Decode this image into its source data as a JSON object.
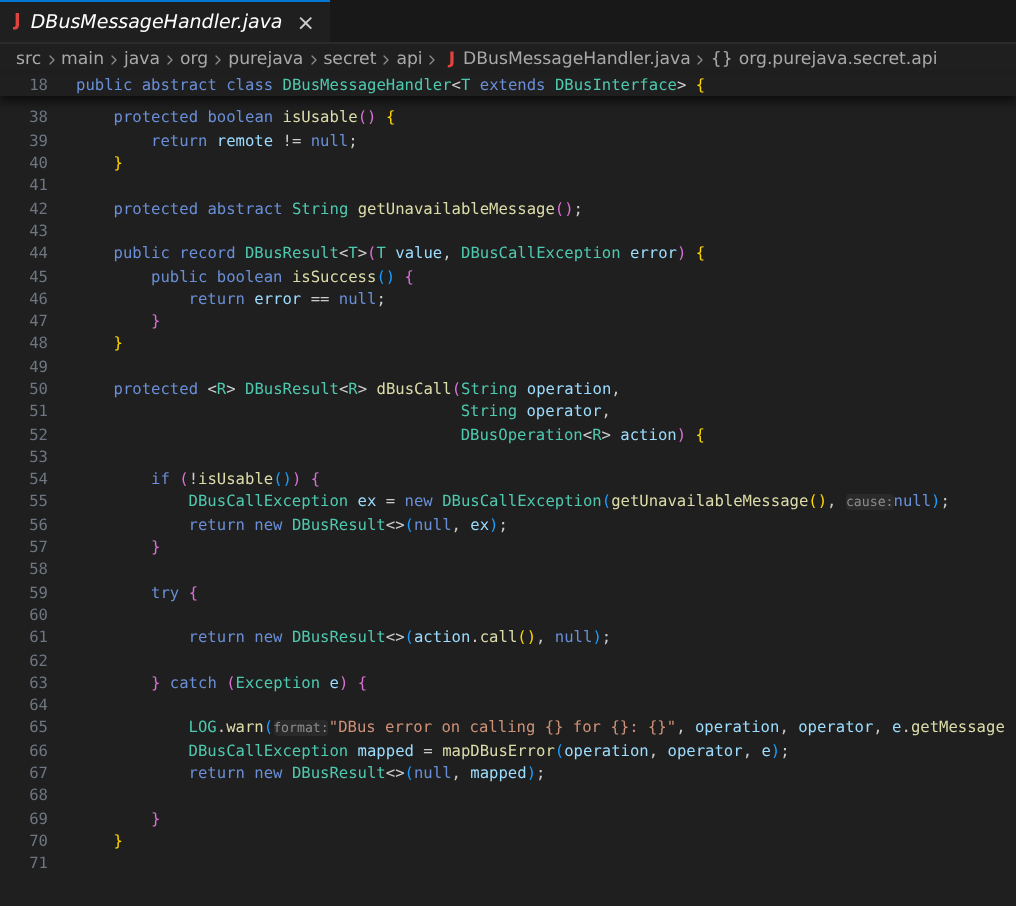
{
  "tab": {
    "icon_glyph": "J",
    "label": "DBusMessageHandler.java",
    "close_glyph": "×",
    "selected": true
  },
  "breadcrumb": {
    "folders": [
      "src",
      "main",
      "java",
      "org",
      "purejava",
      "secret",
      "api"
    ],
    "file": {
      "icon_glyph": "J",
      "label": "DBusMessageHandler.java"
    },
    "symbol": {
      "icon_glyph": "{}",
      "label": "org.purejava.secret.api"
    }
  },
  "sticky_line": {
    "number": "18",
    "tokens": [
      {
        "kind": "kw",
        "text": "public "
      },
      {
        "kind": "kw",
        "text": "abstract "
      },
      {
        "kind": "kw",
        "text": "class "
      },
      {
        "kind": "type",
        "text": "DBusMessageHandler"
      },
      {
        "kind": "plain",
        "text": "<"
      },
      {
        "kind": "type",
        "text": "T "
      },
      {
        "kind": "kw",
        "text": "extends "
      },
      {
        "kind": "type",
        "text": "DBusInterface"
      },
      {
        "kind": "plain",
        "text": "> "
      },
      {
        "kind": "b1",
        "text": "{"
      }
    ]
  },
  "lines": [
    {
      "number": "38",
      "tokens": [
        {
          "kind": "indent"
        },
        {
          "kind": "kw",
          "text": "protected "
        },
        {
          "kind": "kw",
          "text": "boolean "
        },
        {
          "kind": "fn",
          "text": "isUsable"
        },
        {
          "kind": "b2",
          "text": "() "
        },
        {
          "kind": "b1",
          "text": "{"
        }
      ]
    },
    {
      "number": "39",
      "tokens": [
        {
          "kind": "indent"
        },
        {
          "kind": "indent"
        },
        {
          "kind": "kw",
          "text": "return "
        },
        {
          "kind": "var",
          "text": "remote"
        },
        {
          "kind": "plain",
          "text": " != "
        },
        {
          "kind": "kw",
          "text": "null"
        },
        {
          "kind": "plain",
          "text": ";"
        }
      ]
    },
    {
      "number": "40",
      "tokens": [
        {
          "kind": "indent"
        },
        {
          "kind": "b1",
          "text": "}"
        }
      ]
    },
    {
      "number": "41"
    },
    {
      "number": "42",
      "tokens": [
        {
          "kind": "indent"
        },
        {
          "kind": "kw",
          "text": "protected "
        },
        {
          "kind": "kw",
          "text": "abstract "
        },
        {
          "kind": "type",
          "text": "String "
        },
        {
          "kind": "fn",
          "text": "getUnavailableMessage"
        },
        {
          "kind": "b2",
          "text": "()"
        },
        {
          "kind": "plain",
          "text": ";"
        }
      ]
    },
    {
      "number": "43"
    },
    {
      "number": "44",
      "tokens": [
        {
          "kind": "indent"
        },
        {
          "kind": "kw",
          "text": "public "
        },
        {
          "kind": "kw",
          "text": "record "
        },
        {
          "kind": "type",
          "text": "DBusResult"
        },
        {
          "kind": "plain",
          "text": "<"
        },
        {
          "kind": "type",
          "text": "T"
        },
        {
          "kind": "plain",
          "text": ">"
        },
        {
          "kind": "b2",
          "text": "("
        },
        {
          "kind": "type",
          "text": "T "
        },
        {
          "kind": "var",
          "text": "value"
        },
        {
          "kind": "plain",
          "text": ", "
        },
        {
          "kind": "type",
          "text": "DBusCallException "
        },
        {
          "kind": "var",
          "text": "error"
        },
        {
          "kind": "b2",
          "text": ") "
        },
        {
          "kind": "b1",
          "text": "{"
        }
      ]
    },
    {
      "number": "45",
      "tokens": [
        {
          "kind": "indent"
        },
        {
          "kind": "indent"
        },
        {
          "kind": "kw",
          "text": "public "
        },
        {
          "kind": "kw",
          "text": "boolean "
        },
        {
          "kind": "fn",
          "text": "isSuccess"
        },
        {
          "kind": "b3",
          "text": "() "
        },
        {
          "kind": "b2",
          "text": "{"
        }
      ]
    },
    {
      "number": "46",
      "tokens": [
        {
          "kind": "indent"
        },
        {
          "kind": "indent"
        },
        {
          "kind": "indent"
        },
        {
          "kind": "kw",
          "text": "return "
        },
        {
          "kind": "var",
          "text": "error"
        },
        {
          "kind": "plain",
          "text": " == "
        },
        {
          "kind": "kw",
          "text": "null"
        },
        {
          "kind": "plain",
          "text": ";"
        }
      ]
    },
    {
      "number": "47",
      "tokens": [
        {
          "kind": "indent"
        },
        {
          "kind": "indent"
        },
        {
          "kind": "b2",
          "text": "}"
        }
      ]
    },
    {
      "number": "48",
      "tokens": [
        {
          "kind": "indent"
        },
        {
          "kind": "b1",
          "text": "}"
        }
      ]
    },
    {
      "number": "49"
    },
    {
      "number": "50",
      "tokens": [
        {
          "kind": "indent"
        },
        {
          "kind": "kw",
          "text": "protected "
        },
        {
          "kind": "plain",
          "text": "<"
        },
        {
          "kind": "type",
          "text": "R"
        },
        {
          "kind": "plain",
          "text": "> "
        },
        {
          "kind": "type",
          "text": "DBusResult"
        },
        {
          "kind": "plain",
          "text": "<"
        },
        {
          "kind": "type",
          "text": "R"
        },
        {
          "kind": "plain",
          "text": "> "
        },
        {
          "kind": "fn",
          "text": "dBusCall"
        },
        {
          "kind": "b2",
          "text": "("
        },
        {
          "kind": "type",
          "text": "String "
        },
        {
          "kind": "var",
          "text": "operation"
        },
        {
          "kind": "plain",
          "text": ","
        }
      ]
    },
    {
      "number": "51",
      "tokens": [
        {
          "kind": "indent"
        },
        {
          "kind": "indent"
        },
        {
          "kind": "indent"
        },
        {
          "kind": "indent"
        },
        {
          "kind": "indent"
        },
        {
          "kind": "indent"
        },
        {
          "kind": "indent"
        },
        {
          "kind": "indent"
        },
        {
          "kind": "indent"
        },
        {
          "kind": "indent"
        },
        {
          "kind": "type",
          "text": " String "
        },
        {
          "kind": "var",
          "text": "operator"
        },
        {
          "kind": "plain",
          "text": ","
        }
      ]
    },
    {
      "number": "52",
      "tokens": [
        {
          "kind": "indent"
        },
        {
          "kind": "indent"
        },
        {
          "kind": "indent"
        },
        {
          "kind": "indent"
        },
        {
          "kind": "indent"
        },
        {
          "kind": "indent"
        },
        {
          "kind": "indent"
        },
        {
          "kind": "indent"
        },
        {
          "kind": "indent"
        },
        {
          "kind": "indent"
        },
        {
          "kind": "type",
          "text": " DBusOperation"
        },
        {
          "kind": "plain",
          "text": "<"
        },
        {
          "kind": "type",
          "text": "R"
        },
        {
          "kind": "plain",
          "text": "> "
        },
        {
          "kind": "var",
          "text": "action"
        },
        {
          "kind": "b2",
          "text": ") "
        },
        {
          "kind": "b1",
          "text": "{"
        }
      ]
    },
    {
      "number": "53"
    },
    {
      "number": "54",
      "tokens": [
        {
          "kind": "indent"
        },
        {
          "kind": "indent"
        },
        {
          "kind": "kw",
          "text": "if "
        },
        {
          "kind": "b2",
          "text": "("
        },
        {
          "kind": "plain",
          "text": "!"
        },
        {
          "kind": "fn",
          "text": "isUsable"
        },
        {
          "kind": "b3",
          "text": "()"
        },
        {
          "kind": "b2",
          "text": ") "
        },
        {
          "kind": "b2",
          "text": "{"
        }
      ]
    },
    {
      "number": "55",
      "tokens": [
        {
          "kind": "indent"
        },
        {
          "kind": "indent"
        },
        {
          "kind": "indent"
        },
        {
          "kind": "type",
          "text": "DBusCallException "
        },
        {
          "kind": "var",
          "text": "ex"
        },
        {
          "kind": "plain",
          "text": " = "
        },
        {
          "kind": "kw",
          "text": "new "
        },
        {
          "kind": "type",
          "text": "DBusCallException"
        },
        {
          "kind": "b3",
          "text": "("
        },
        {
          "kind": "fn",
          "text": "getUnavailableMessage"
        },
        {
          "kind": "b1",
          "text": "()"
        },
        {
          "kind": "plain",
          "text": ", "
        },
        {
          "kind": "hint",
          "text": "cause:"
        },
        {
          "kind": "kw",
          "text": "null"
        },
        {
          "kind": "b3",
          "text": ")"
        },
        {
          "kind": "plain",
          "text": ";"
        }
      ]
    },
    {
      "number": "56",
      "tokens": [
        {
          "kind": "indent"
        },
        {
          "kind": "indent"
        },
        {
          "kind": "indent"
        },
        {
          "kind": "kw",
          "text": "return "
        },
        {
          "kind": "kw",
          "text": "new "
        },
        {
          "kind": "type",
          "text": "DBusResult"
        },
        {
          "kind": "plain",
          "text": "<>"
        },
        {
          "kind": "b3",
          "text": "("
        },
        {
          "kind": "kw",
          "text": "null"
        },
        {
          "kind": "plain",
          "text": ", "
        },
        {
          "kind": "var",
          "text": "ex"
        },
        {
          "kind": "b3",
          "text": ")"
        },
        {
          "kind": "plain",
          "text": ";"
        }
      ]
    },
    {
      "number": "57",
      "tokens": [
        {
          "kind": "indent"
        },
        {
          "kind": "indent"
        },
        {
          "kind": "b2",
          "text": "}"
        }
      ]
    },
    {
      "number": "58"
    },
    {
      "number": "59",
      "tokens": [
        {
          "kind": "indent"
        },
        {
          "kind": "indent"
        },
        {
          "kind": "kw",
          "text": "try "
        },
        {
          "kind": "b2",
          "text": "{"
        }
      ]
    },
    {
      "number": "60"
    },
    {
      "number": "61",
      "tokens": [
        {
          "kind": "indent"
        },
        {
          "kind": "indent"
        },
        {
          "kind": "indent"
        },
        {
          "kind": "kw",
          "text": "return "
        },
        {
          "kind": "kw",
          "text": "new "
        },
        {
          "kind": "type",
          "text": "DBusResult"
        },
        {
          "kind": "plain",
          "text": "<>"
        },
        {
          "kind": "b3",
          "text": "("
        },
        {
          "kind": "var",
          "text": "action"
        },
        {
          "kind": "plain",
          "text": "."
        },
        {
          "kind": "fn",
          "text": "call"
        },
        {
          "kind": "b1",
          "text": "()"
        },
        {
          "kind": "plain",
          "text": ", "
        },
        {
          "kind": "kw",
          "text": "null"
        },
        {
          "kind": "b3",
          "text": ")"
        },
        {
          "kind": "plain",
          "text": ";"
        }
      ]
    },
    {
      "number": "62"
    },
    {
      "number": "63",
      "tokens": [
        {
          "kind": "indent"
        },
        {
          "kind": "indent"
        },
        {
          "kind": "b2",
          "text": "} "
        },
        {
          "kind": "kw",
          "text": "catch "
        },
        {
          "kind": "b2",
          "text": "("
        },
        {
          "kind": "type",
          "text": "Exception "
        },
        {
          "kind": "var",
          "text": "e"
        },
        {
          "kind": "b2",
          "text": ") "
        },
        {
          "kind": "b2",
          "text": "{"
        }
      ]
    },
    {
      "number": "64"
    },
    {
      "number": "65",
      "tokens": [
        {
          "kind": "indent"
        },
        {
          "kind": "indent"
        },
        {
          "kind": "indent"
        },
        {
          "kind": "type",
          "text": "LOG"
        },
        {
          "kind": "plain",
          "text": "."
        },
        {
          "kind": "fn",
          "text": "warn"
        },
        {
          "kind": "b3",
          "text": "("
        },
        {
          "kind": "hint",
          "text": "format:"
        },
        {
          "kind": "str",
          "text": "\"DBus error on calling {} for {}: {}\""
        },
        {
          "kind": "plain",
          "text": ", "
        },
        {
          "kind": "var",
          "text": "operation"
        },
        {
          "kind": "plain",
          "text": ", "
        },
        {
          "kind": "var",
          "text": "operator"
        },
        {
          "kind": "plain",
          "text": ", "
        },
        {
          "kind": "var",
          "text": "e"
        },
        {
          "kind": "plain",
          "text": "."
        },
        {
          "kind": "fn",
          "text": "getMessage"
        }
      ]
    },
    {
      "number": "66",
      "tokens": [
        {
          "kind": "indent"
        },
        {
          "kind": "indent"
        },
        {
          "kind": "indent"
        },
        {
          "kind": "type",
          "text": "DBusCallException "
        },
        {
          "kind": "var",
          "text": "mapped"
        },
        {
          "kind": "plain",
          "text": " = "
        },
        {
          "kind": "fn",
          "text": "mapDBusError"
        },
        {
          "kind": "b3",
          "text": "("
        },
        {
          "kind": "var",
          "text": "operation"
        },
        {
          "kind": "plain",
          "text": ", "
        },
        {
          "kind": "var",
          "text": "operator"
        },
        {
          "kind": "plain",
          "text": ", "
        },
        {
          "kind": "var",
          "text": "e"
        },
        {
          "kind": "b3",
          "text": ")"
        },
        {
          "kind": "plain",
          "text": ";"
        }
      ]
    },
    {
      "number": "67",
      "tokens": [
        {
          "kind": "indent"
        },
        {
          "kind": "indent"
        },
        {
          "kind": "indent"
        },
        {
          "kind": "kw",
          "text": "return "
        },
        {
          "kind": "kw",
          "text": "new "
        },
        {
          "kind": "type",
          "text": "DBusResult"
        },
        {
          "kind": "plain",
          "text": "<>"
        },
        {
          "kind": "b3",
          "text": "("
        },
        {
          "kind": "kw",
          "text": "null"
        },
        {
          "kind": "plain",
          "text": ", "
        },
        {
          "kind": "var",
          "text": "mapped"
        },
        {
          "kind": "b3",
          "text": ")"
        },
        {
          "kind": "plain",
          "text": ";"
        }
      ]
    },
    {
      "number": "68"
    },
    {
      "number": "69",
      "tokens": [
        {
          "kind": "indent"
        },
        {
          "kind": "indent"
        },
        {
          "kind": "b2",
          "text": "}"
        }
      ]
    },
    {
      "number": "70",
      "tokens": [
        {
          "kind": "indent"
        },
        {
          "kind": "b1",
          "text": "}"
        }
      ]
    },
    {
      "number": "71"
    }
  ]
}
